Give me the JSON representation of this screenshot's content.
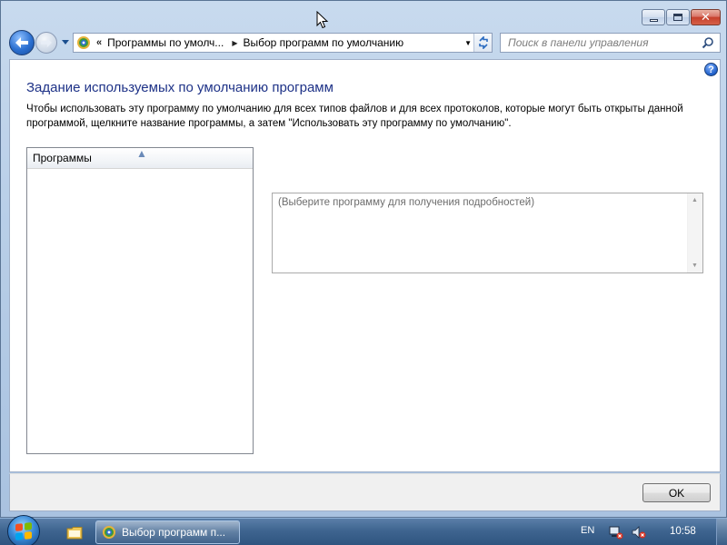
{
  "window": {
    "address": {
      "chevron": "«",
      "crumb_1": "Программы по умолч...",
      "crumb_2": "Выбор программ по умолчанию"
    },
    "search": {
      "placeholder": "Поиск в панели управления"
    },
    "caption_buttons": {
      "close_glyph": "✕"
    }
  },
  "content": {
    "help_glyph": "?",
    "title": "Задание используемых по умолчанию программ",
    "description": "Чтобы использовать эту программу по умолчанию для всех типов файлов и для всех протоколов, которые могут быть открыты данной программой, щелкните название программы, а затем \"Использовать эту программу по умолчанию\".",
    "programs_list": {
      "header": "Программы",
      "items": []
    },
    "details_placeholder": "(Выберите программу для получения подробностей)"
  },
  "buttons": {
    "ok": "OK"
  },
  "taskbar": {
    "active_task": "Выбор программ п...",
    "language": "EN",
    "clock": "10:58"
  },
  "icons": {
    "back": "arrow-left-icon",
    "forward": "arrow-right-icon",
    "control_panel": "control-panel-icon",
    "refresh": "refresh-icon",
    "search": "search-icon",
    "help": "help-icon",
    "explorer": "folder-icon",
    "network": "network-icon",
    "volume": "volume-muted-icon"
  },
  "colors": {
    "title_blue": "#1e3287",
    "taskbar": "#3f6590",
    "close_red": "#c6402c"
  }
}
